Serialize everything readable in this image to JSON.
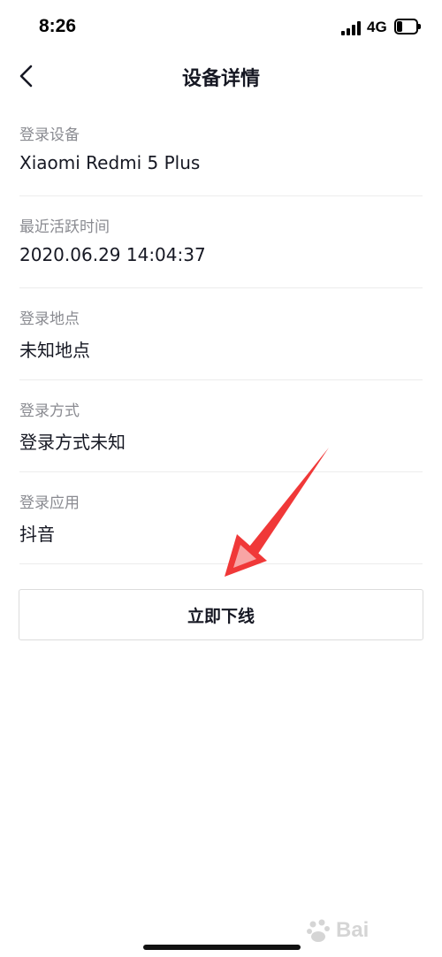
{
  "status_bar": {
    "time": "8:26",
    "network": "4G",
    "icons": [
      "signal-icon",
      "battery-icon"
    ],
    "battery_level": 0.3
  },
  "nav": {
    "back_icon": "chevron-left-icon",
    "title": "设备详情"
  },
  "details": [
    {
      "label": "登录设备",
      "value": "Xiaomi Redmi 5 Plus"
    },
    {
      "label": "最近活跃时间",
      "value": "2020.06.29 14:04:37"
    },
    {
      "label": "登录地点",
      "value": "未知地点"
    },
    {
      "label": "登录方式",
      "value": "登录方式未知"
    },
    {
      "label": "登录应用",
      "value": "抖音"
    }
  ],
  "actions": {
    "logout_label": "立即下线"
  },
  "colors": {
    "text_primary": "#161823",
    "text_secondary": "#8a8b91",
    "divider": "#ececec",
    "annotation_arrow": "#f03838"
  },
  "watermark": {
    "text": "Bai"
  }
}
